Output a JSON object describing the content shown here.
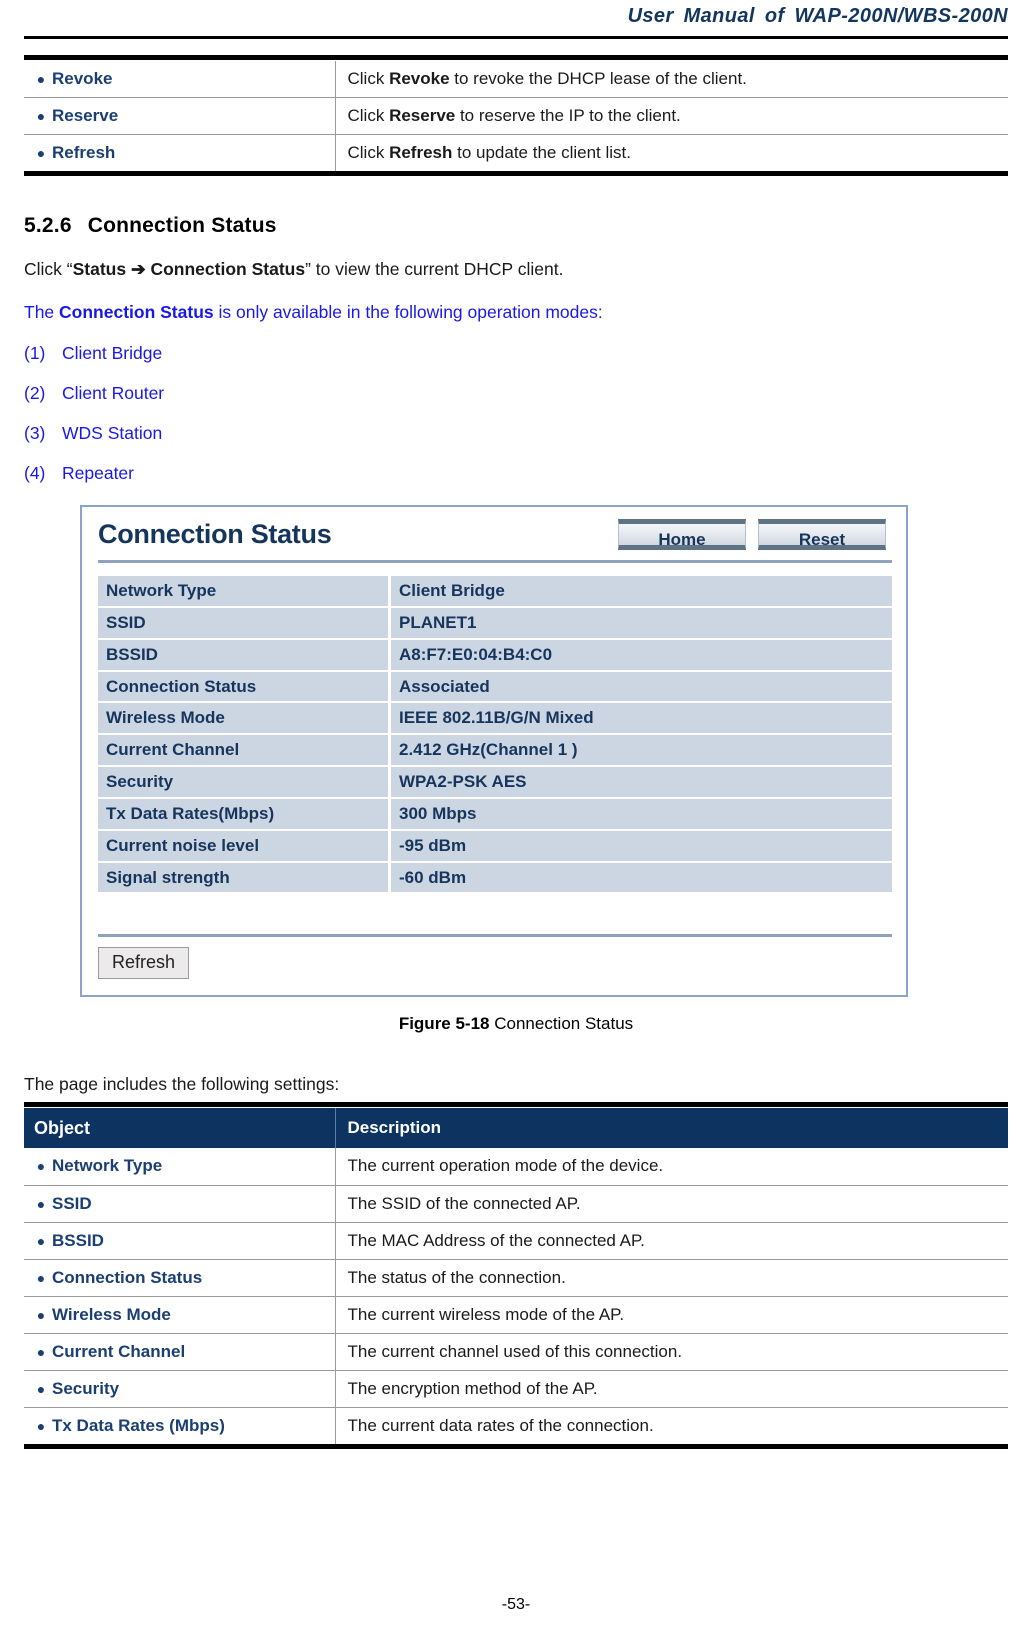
{
  "header": {
    "running_title": "User Manual of WAP-200N/WBS-200N"
  },
  "top_table": {
    "rows": [
      {
        "object": "Revoke",
        "desc_pre": "Click ",
        "desc_bold": "Revoke",
        "desc_post": " to revoke the DHCP lease of the client."
      },
      {
        "object": "Reserve",
        "desc_pre": "Click ",
        "desc_bold": "Reserve",
        "desc_post": " to reserve the IP to the client."
      },
      {
        "object": "Refresh",
        "desc_pre": "Click ",
        "desc_bold": "Refresh",
        "desc_post": " to update the client list."
      }
    ]
  },
  "section": {
    "number": "5.2.6",
    "title": "Connection Status",
    "intro_pre": "Click “",
    "intro_bold": "Status ➔ Connection Status",
    "intro_post": "” to view the current DHCP client.",
    "note_pre": "The ",
    "note_bold": "Connection Status",
    "note_post": " is only available in the following operation modes:",
    "modes": [
      {
        "index": "(1)",
        "label": "Client Bridge"
      },
      {
        "index": "(2)",
        "label": "Client Router"
      },
      {
        "index": "(3)",
        "label": "WDS Station"
      },
      {
        "index": "(4)",
        "label": "Repeater"
      }
    ]
  },
  "screenshot": {
    "title": "Connection Status",
    "buttons": {
      "home": "Home",
      "reset": "Reset",
      "refresh": "Refresh"
    },
    "rows": [
      {
        "key": "Network Type",
        "value": "Client Bridge"
      },
      {
        "key": "SSID",
        "value": "PLANET1"
      },
      {
        "key": "BSSID",
        "value": "A8:F7:E0:04:B4:C0"
      },
      {
        "key": "Connection Status",
        "value": "Associated"
      },
      {
        "key": "Wireless Mode",
        "value": "IEEE 802.11B/G/N Mixed"
      },
      {
        "key": "Current Channel",
        "value": "2.412 GHz(Channel 1 )"
      },
      {
        "key": "Security",
        "value": "WPA2-PSK AES"
      },
      {
        "key": "Tx Data Rates(Mbps)",
        "value": "300 Mbps"
      },
      {
        "key": "Current noise level",
        "value": "-95 dBm"
      },
      {
        "key": "Signal strength",
        "value": "-60 dBm"
      }
    ]
  },
  "figure": {
    "label": "Figure 5-18",
    "caption": "Connection Status"
  },
  "settings_intro": "The page includes the following settings:",
  "bottom_table": {
    "headers": {
      "object": "Object",
      "description": "Description"
    },
    "rows": [
      {
        "object": "Network Type",
        "desc": "The current operation mode of the device."
      },
      {
        "object": "SSID",
        "desc": "The SSID of the connected AP."
      },
      {
        "object": "BSSID",
        "desc": "The MAC Address of the connected AP."
      },
      {
        "object": "Connection Status",
        "desc": "The status of the connection."
      },
      {
        "object": "Wireless Mode",
        "desc": "The current wireless mode of the AP."
      },
      {
        "object": "Current Channel",
        "desc": "The current channel used of this connection."
      },
      {
        "object": "Security",
        "desc": "The encryption method of the AP."
      },
      {
        "object": "Tx Data Rates (Mbps)",
        "desc": "The current data rates of the connection."
      }
    ]
  },
  "footer": {
    "page_number": "-53-"
  },
  "colors": {
    "heading_blue": "#1b3f72",
    "link_blue": "#1919e6",
    "table_header_bg": "#0d3360",
    "ui_panel_blue": "#16355c",
    "ui_row_bg": "#ccd6e3"
  }
}
